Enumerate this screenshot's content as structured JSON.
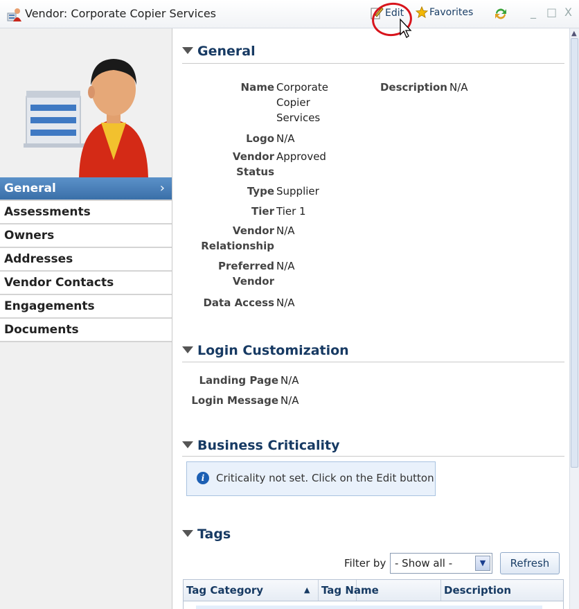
{
  "window": {
    "title": "Vendor: Corporate Copier Services",
    "edit_label": "Edit",
    "favorites_label": "Favorites",
    "min_glyph": "_",
    "max_glyph": "□",
    "close_glyph": "X"
  },
  "sidebar": {
    "items": [
      {
        "label": "General",
        "active": true
      },
      {
        "label": "Assessments"
      },
      {
        "label": "Owners"
      },
      {
        "label": "Addresses"
      },
      {
        "label": "Vendor Contacts"
      },
      {
        "label": "Engagements"
      },
      {
        "label": "Documents"
      }
    ],
    "active_chevron": "›"
  },
  "general": {
    "heading": "General",
    "name_label": "Name",
    "name_value_1": "Corporate",
    "name_value_2": "Copier",
    "name_value_3": "Services",
    "description_label": "Description",
    "description_value": "N/A",
    "logo_label": "Logo",
    "logo_value": "N/A",
    "vendor_status_label_1": "Vendor",
    "vendor_status_label_2": "Status",
    "vendor_status_value": "Approved",
    "type_label": "Type",
    "type_value": "Supplier",
    "tier_label": "Tier",
    "tier_value": "Tier 1",
    "vendor_relationship_label_1": "Vendor",
    "vendor_relationship_label_2": "Relationship",
    "vendor_relationship_value": "N/A",
    "preferred_vendor_label_1": "Preferred",
    "preferred_vendor_label_2": "Vendor",
    "preferred_vendor_value": "N/A",
    "data_access_label": "Data Access",
    "data_access_value": "N/A"
  },
  "login": {
    "heading": "Login Customization",
    "landing_page_label": "Landing Page",
    "landing_page_value": "N/A",
    "login_message_label": "Login Message",
    "login_message_value": "N/A"
  },
  "criticality": {
    "heading": "Business Criticality",
    "info_text": "Criticality not set. Click on the Edit button"
  },
  "tags": {
    "heading": "Tags",
    "filter_label": "Filter by",
    "filter_value": "- Show all -",
    "refresh_label": "Refresh",
    "columns": [
      "Tag Category",
      "Tag Name",
      "Description"
    ]
  },
  "colors": {
    "accent": "#3a6fa8",
    "heading": "#173a63",
    "annotation": "#d8141c"
  }
}
